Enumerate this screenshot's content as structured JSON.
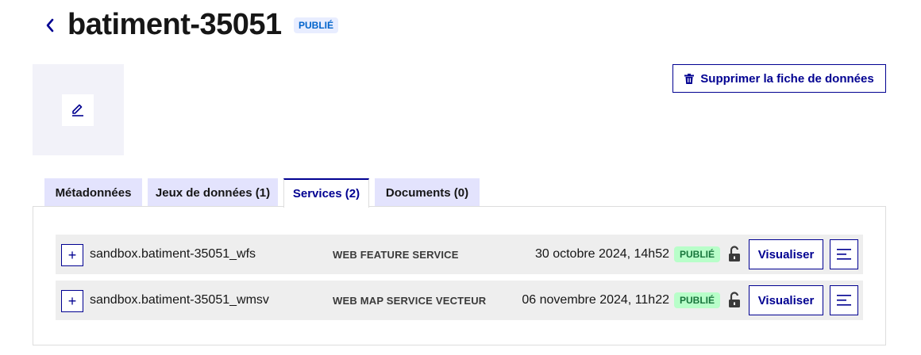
{
  "header": {
    "title": "batiment-35051",
    "status_badge": "PUBLIÉ",
    "back_icon": "chevron-left-icon"
  },
  "thumbnail": {
    "edit_icon": "pencil-icon"
  },
  "actions": {
    "delete_label": "Supprimer la fiche de données",
    "delete_icon": "trash-icon"
  },
  "tabs": [
    {
      "label": "Métadonnées",
      "active": false
    },
    {
      "label": "Jeux de données (1)",
      "active": false
    },
    {
      "label": "Services (2)",
      "active": true
    },
    {
      "label": "Documents (0)",
      "active": false
    }
  ],
  "services": [
    {
      "expand_label": "+",
      "name": "sandbox.batiment-35051_wfs",
      "type": "WEB FEATURE SERVICE",
      "date": "30 octobre 2024, 14h52",
      "status": "PUBLIÉ",
      "lock_icon": "unlock-icon",
      "view_label": "Visualiser",
      "menu_icon": "menu-icon"
    },
    {
      "expand_label": "+",
      "name": "sandbox.batiment-35051_wmsv",
      "type": "WEB MAP SERVICE VECTEUR",
      "date": "06 novembre 2024, 11h22",
      "status": "PUBLIÉ",
      "lock_icon": "unlock-icon",
      "view_label": "Visualiser",
      "menu_icon": "menu-icon"
    }
  ],
  "colors": {
    "primary": "#000091",
    "tab_bg": "#e3e3fd",
    "badge_blue_bg": "#e8edff",
    "badge_blue_text": "#0063cb",
    "badge_green_bg": "#b8fec9",
    "badge_green_text": "#18753c",
    "row_bg": "#eeeeee"
  }
}
